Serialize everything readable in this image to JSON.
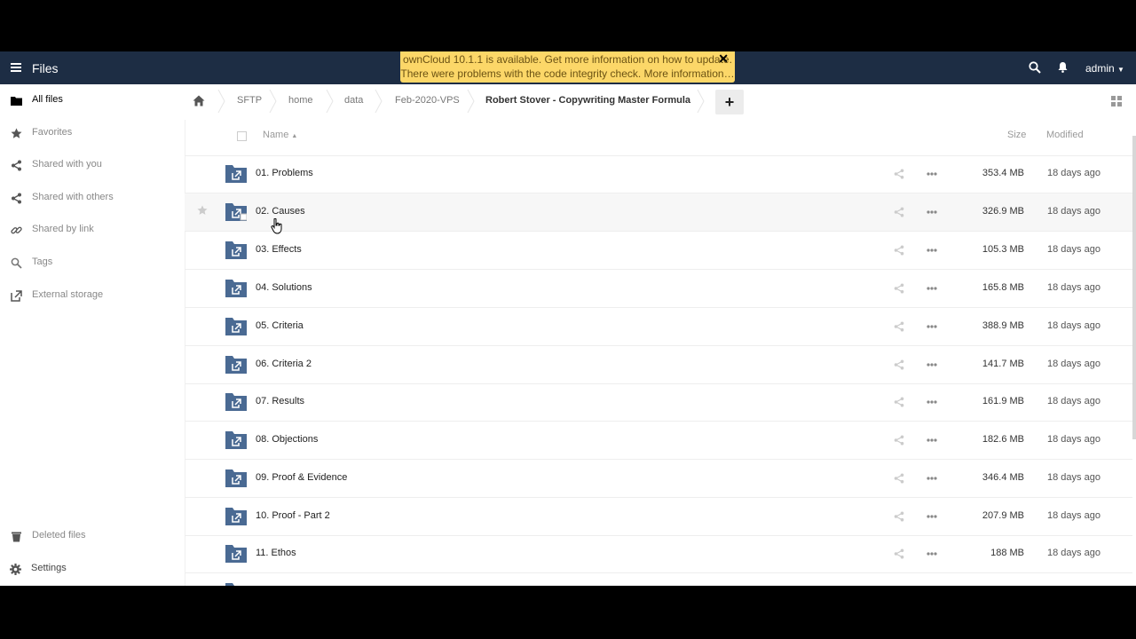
{
  "header": {
    "app_title": "Files",
    "user": "admin",
    "icons": [
      "menu-icon",
      "search-icon",
      "bell-icon",
      "caret-down-icon"
    ]
  },
  "notification": {
    "line1": "ownCloud 10.1.1 is available. Get more information on how to update.",
    "line2": "There were problems with the code integrity check. More information…",
    "close": "✕"
  },
  "sidebar": {
    "items": [
      {
        "label": "All files",
        "icon": "folder-icon",
        "active": true
      },
      {
        "label": "Favorites",
        "icon": "star-icon"
      },
      {
        "label": "Shared with you",
        "icon": "share-icon"
      },
      {
        "label": "Shared with others",
        "icon": "share-icon"
      },
      {
        "label": "Shared by link",
        "icon": "link-icon"
      },
      {
        "label": "Tags",
        "icon": "tag-icon"
      },
      {
        "label": "External storage",
        "icon": "external-icon"
      }
    ],
    "deleted": "Deleted files",
    "settings": "Settings"
  },
  "breadcrumb": [
    "SFTP",
    "home",
    "data",
    "Feb-2020-VPS",
    "Robert Stover - Copywriting Master Formula"
  ],
  "add_label": "+",
  "table": {
    "col_name": "Name",
    "col_size": "Size",
    "col_modified": "Modified",
    "rows": [
      {
        "name": "01. Problems",
        "size": "353.4 MB",
        "modified": "18 days ago"
      },
      {
        "name": "02. Causes",
        "size": "326.9 MB",
        "modified": "18 days ago"
      },
      {
        "name": "03. Effects",
        "size": "105.3 MB",
        "modified": "18 days ago"
      },
      {
        "name": "04. Solutions",
        "size": "165.8 MB",
        "modified": "18 days ago"
      },
      {
        "name": "05. Criteria",
        "size": "388.9 MB",
        "modified": "18 days ago"
      },
      {
        "name": "06. Criteria 2",
        "size": "141.7 MB",
        "modified": "18 days ago"
      },
      {
        "name": "07. Results",
        "size": "161.9 MB",
        "modified": "18 days ago"
      },
      {
        "name": "08. Objections",
        "size": "182.6 MB",
        "modified": "18 days ago"
      },
      {
        "name": "09. Proof & Evidence",
        "size": "346.4 MB",
        "modified": "18 days ago"
      },
      {
        "name": "10. Proof - Part 2",
        "size": "207.9 MB",
        "modified": "18 days ago"
      },
      {
        "name": "11. Ethos",
        "size": "188 MB",
        "modified": "18 days ago"
      }
    ]
  },
  "colors": {
    "header_bg": "#1d2d44",
    "notification_bg": "#fcd768",
    "folder": "#4a6a93"
  }
}
